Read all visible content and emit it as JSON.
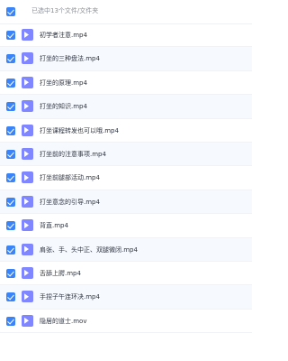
{
  "header": {
    "summary": "已选中13个文件/文件夹"
  },
  "files": [
    {
      "name": "初学者注意.mp4",
      "type": "video"
    },
    {
      "name": "打坐的三种盘法.mp4",
      "type": "video"
    },
    {
      "name": "打坐的原理.mp4",
      "type": "video"
    },
    {
      "name": "打坐的知识.mp4",
      "type": "video"
    },
    {
      "name": "打坐课程转发也可以哦.mp4",
      "type": "video"
    },
    {
      "name": "打坐前的注意事项.mp4",
      "type": "video"
    },
    {
      "name": "打坐前腿部活动.mp4",
      "type": "video"
    },
    {
      "name": "打坐意念的引导.mp4",
      "type": "video"
    },
    {
      "name": "背直.mp4",
      "type": "video"
    },
    {
      "name": "肩张、手、头中正、双腿微闭.mp4",
      "type": "video"
    },
    {
      "name": "舌舔上腭.mp4",
      "type": "video"
    },
    {
      "name": "手捏子午连环决.mp4",
      "type": "video"
    },
    {
      "name": "隐居的道士.mov",
      "type": "video"
    }
  ],
  "colors": {
    "accent": "#3a84f7",
    "video_icon": "#7f86ff",
    "row_alt": "#f6f9fe"
  }
}
